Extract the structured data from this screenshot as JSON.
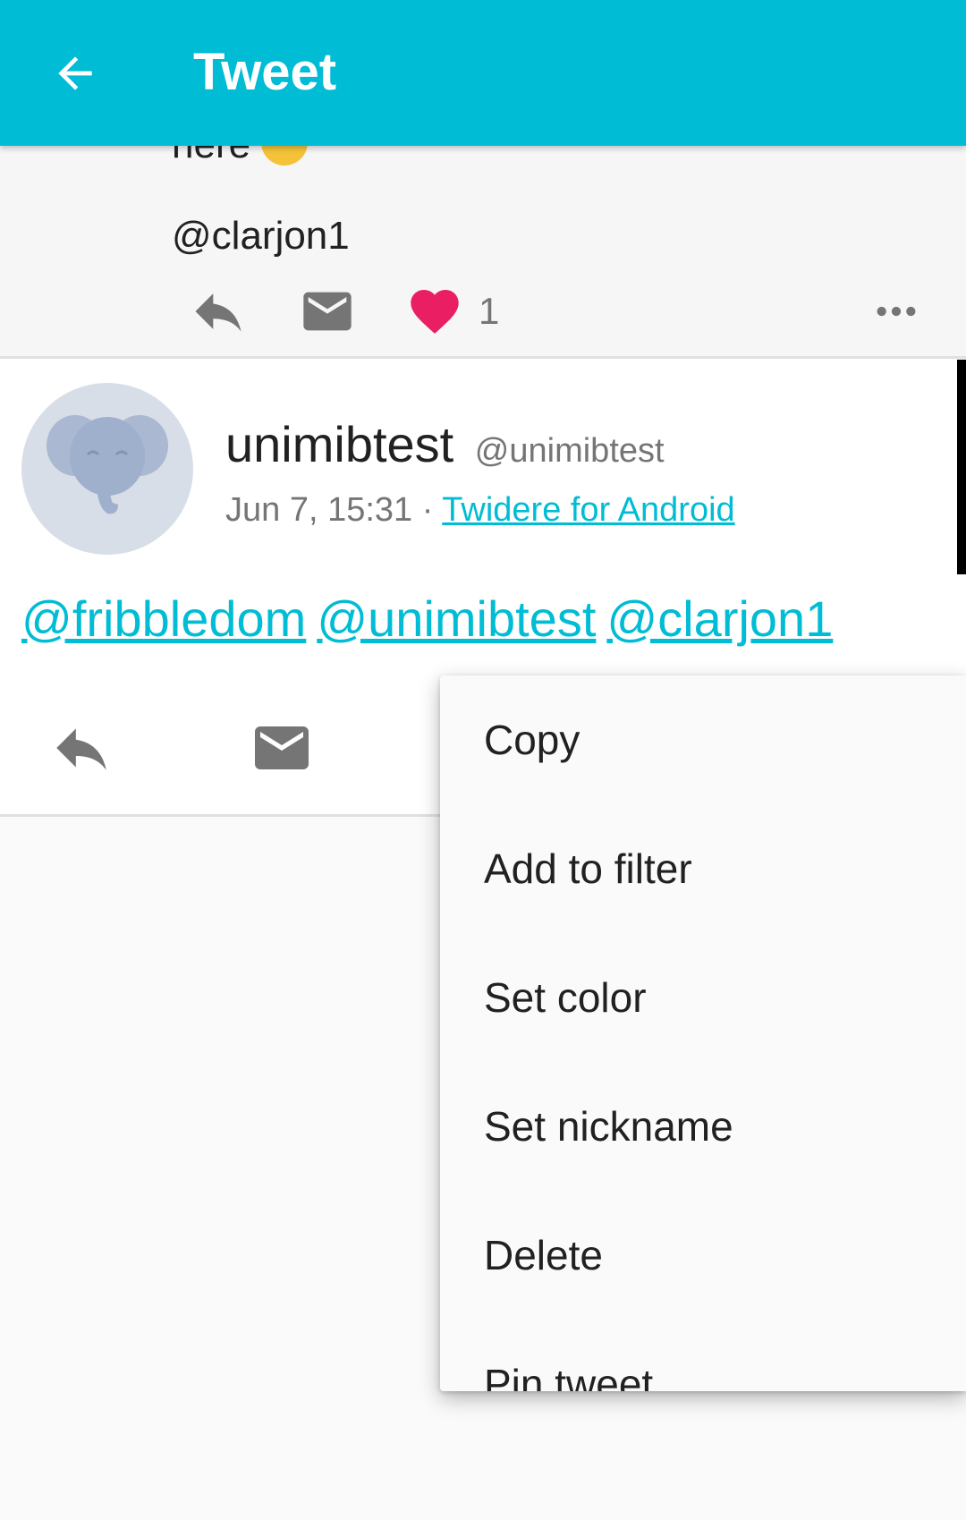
{
  "appbar": {
    "title": "Tweet"
  },
  "previous_tweet": {
    "text_fragment": "here",
    "mention": "@clarjon1",
    "like_count": "1"
  },
  "tweet": {
    "display_name": "unimibtest",
    "screen_name": "@unimibtest",
    "time": "Jun 7, 15:31",
    "separator": "·",
    "source": "Twidere for Android",
    "mentions": [
      "@fribbledom",
      "@unimibtest",
      "@clarjon1"
    ]
  },
  "context_menu": {
    "items": [
      "Copy",
      "Add to filter",
      "Set color",
      "Set nickname",
      "Delete",
      "Pin tweet"
    ]
  },
  "colors": {
    "accent": "#00bcd4",
    "like": "#e91e63",
    "icon": "#757575"
  }
}
